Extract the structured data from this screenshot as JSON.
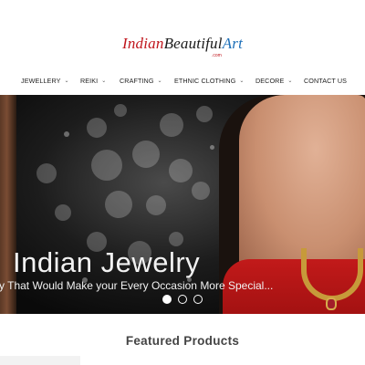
{
  "logo": {
    "part1": "Indian",
    "part2": "Beautiful",
    "part3": "Art",
    "sub": ".com"
  },
  "nav": {
    "items": [
      {
        "label": "Jewellery",
        "has_dropdown": true
      },
      {
        "label": "Reiki",
        "has_dropdown": true
      },
      {
        "label": "Crafting",
        "has_dropdown": true
      },
      {
        "label": "Ethnic Clothing",
        "has_dropdown": true
      },
      {
        "label": "Decore",
        "has_dropdown": true
      },
      {
        "label": "Contact Us",
        "has_dropdown": false
      }
    ],
    "chevron": "⌄"
  },
  "slider": {
    "title": "Indian Jewelry",
    "subtitle": "y That Would Make your Every Occasion More Special...",
    "active_slide": 1,
    "slide_count": 3
  },
  "featured": {
    "heading": "Featured Products"
  },
  "colors": {
    "logo_red": "#c0161d",
    "logo_blue": "#1d6fb8",
    "dress_red": "#c21a1a"
  }
}
